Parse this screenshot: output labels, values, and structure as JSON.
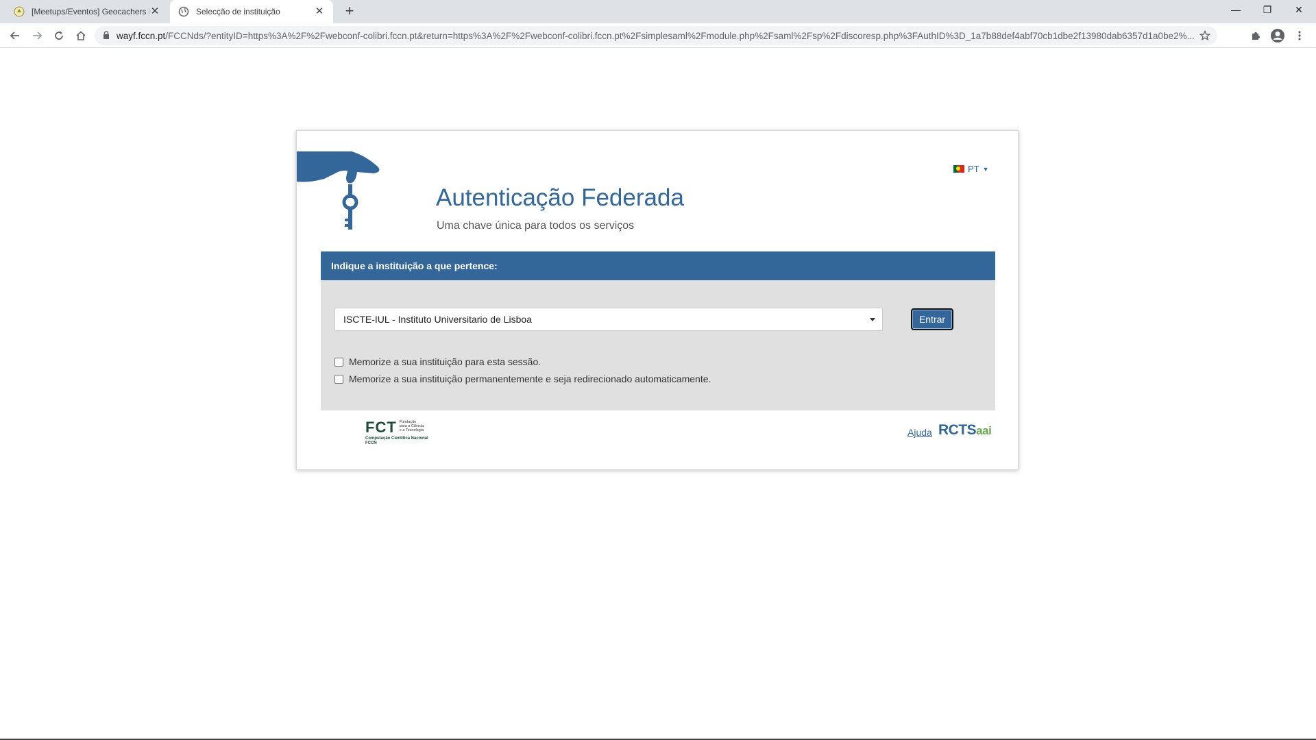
{
  "browser": {
    "tabs": [
      {
        "title": "[Meetups/Eventos] Geocachers N",
        "active": false
      },
      {
        "title": "Selecção de instituição",
        "active": true
      }
    ],
    "url_host": "wayf.fccn.pt",
    "url_path": "/FCCNds/?entityID=https%3A%2F%2Fwebconf-colibri.fccn.pt&return=https%3A%2F%2Fwebconf-colibri.fccn.pt%2Fsimplesaml%2Fmodule.php%2Fsaml%2Fsp%2Fdiscoresp.php%3FAuthID%3D_1a7b88def4abf70cb1dbe2f13980dab6357d1a0be2%..."
  },
  "page": {
    "language": "PT",
    "title": "Autenticação Federada",
    "subtitle": "Uma chave única para todos os serviços",
    "panel_heading": "Indique a instituição a que pertence:",
    "selected_institution": "ISCTE-IUL - Instituto Universitario de Lisboa",
    "submit_label": "Entrar",
    "checkbox_session": "Memorize a sua instituição para esta sessão.",
    "checkbox_permanent": "Memorize a sua instituição permanentemente e seja redirecionado automaticamente.",
    "help_link": "Ajuda",
    "fct_logo": {
      "acronym": "FCT",
      "line1": "Fundação",
      "line2": "para a Ciência",
      "line3": "e a Tecnologia",
      "sub1": "Computação Científica Nacional",
      "sub2": "FCCN"
    },
    "rcts_logo": {
      "main": "RCTS",
      "suffix": "aai"
    }
  },
  "colors": {
    "primary": "#336699",
    "panel_bg": "#e0e0e0",
    "fct_green": "#1f4a3a",
    "aai_green": "#6aa84f"
  }
}
